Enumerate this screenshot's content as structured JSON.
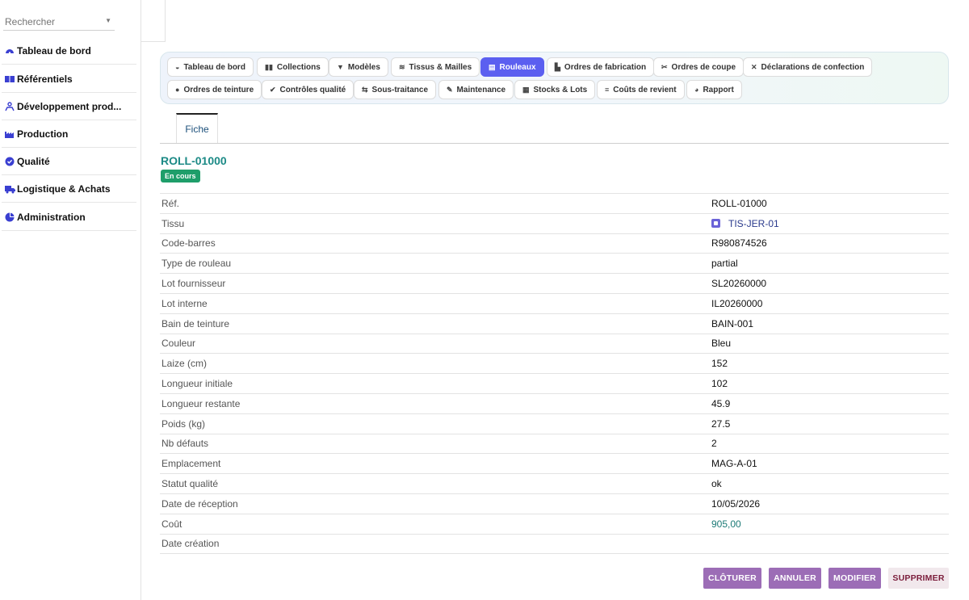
{
  "sidebar": {
    "search": {
      "placeholder": "Rechercher"
    },
    "items": [
      {
        "label": "Tableau de bord",
        "icon": "dashboard-icon"
      },
      {
        "label": "Référentiels",
        "icon": "book-icon"
      },
      {
        "label": "Développement prod...",
        "icon": "users-icon"
      },
      {
        "label": "Production",
        "icon": "factory-icon"
      },
      {
        "label": "Qualité",
        "icon": "check-circle-icon"
      },
      {
        "label": "Logistique & Achats",
        "icon": "truck-icon"
      },
      {
        "label": "Administration",
        "icon": "pie-chart-icon"
      }
    ]
  },
  "tabs": {
    "row1": [
      {
        "label": "Tableau de bord",
        "icon": "dashboard-icon"
      },
      {
        "label": "Collections",
        "icon": "book-icon"
      },
      {
        "label": "Modèles",
        "icon": "shirt-icon"
      },
      {
        "label": "Tissus & Mailles",
        "icon": "layers-icon"
      },
      {
        "label": "Rouleaux",
        "icon": "scroll-icon",
        "active": true
      },
      {
        "label": "Ordres de fabrication",
        "icon": "factory-icon"
      },
      {
        "label": "Ordres de coupe",
        "icon": "scissors-icon"
      },
      {
        "label": "Déclarations de confection",
        "icon": "tools-icon"
      }
    ],
    "row2": [
      {
        "label": "Ordres de teinture",
        "icon": "drop-icon"
      },
      {
        "label": "Contrôles qualité",
        "icon": "check-circle-icon"
      },
      {
        "label": "Sous-traitance",
        "icon": "handshake-icon"
      },
      {
        "label": "Maintenance",
        "icon": "wrench-icon"
      },
      {
        "label": "Stocks & Lots",
        "icon": "warehouse-icon"
      },
      {
        "label": "Coûts de revient",
        "icon": "coins-icon"
      },
      {
        "label": "Rapport",
        "icon": "pie-chart-icon"
      }
    ]
  },
  "record": {
    "tab_label": "Fiche",
    "title": "ROLL-01000",
    "status": "En cours",
    "fields": [
      {
        "label": "Réf.",
        "value": "ROLL-01000"
      },
      {
        "label": "Tissu",
        "value": "TIS-JER-01"
      },
      {
        "label": "Code-barres",
        "value": "R980874526"
      },
      {
        "label": "Type de rouleau",
        "value": "partial"
      },
      {
        "label": "Lot fournisseur",
        "value": "SL20260000"
      },
      {
        "label": "Lot interne",
        "value": "IL20260000"
      },
      {
        "label": "Bain de teinture",
        "value": "BAIN-001"
      },
      {
        "label": "Couleur",
        "value": "Bleu"
      },
      {
        "label": "Laize (cm)",
        "value": "152"
      },
      {
        "label": "Longueur initiale",
        "value": "102"
      },
      {
        "label": "Longueur restante",
        "value": "45.9"
      },
      {
        "label": "Poids (kg)",
        "value": "27.5"
      },
      {
        "label": "Nb défauts",
        "value": "2"
      },
      {
        "label": "Emplacement",
        "value": "MAG-A-01"
      },
      {
        "label": "Statut qualité",
        "value": "ok"
      },
      {
        "label": "Date de réception",
        "value": "10/05/2026"
      },
      {
        "label": "Coût",
        "value": "905,00"
      },
      {
        "label": "Date création",
        "value": ""
      }
    ]
  },
  "actions": {
    "close": "CLÔTURER",
    "cancel": "ANNULER",
    "edit": "MODIFIER",
    "delete": "SUPPRIMER"
  },
  "colors": {
    "accent": "#5b5ff0",
    "title": "#1c8a86",
    "status_badge": "#1e9e6a",
    "action_button": "#9c6db6",
    "delete_text": "#7b1d3b"
  }
}
